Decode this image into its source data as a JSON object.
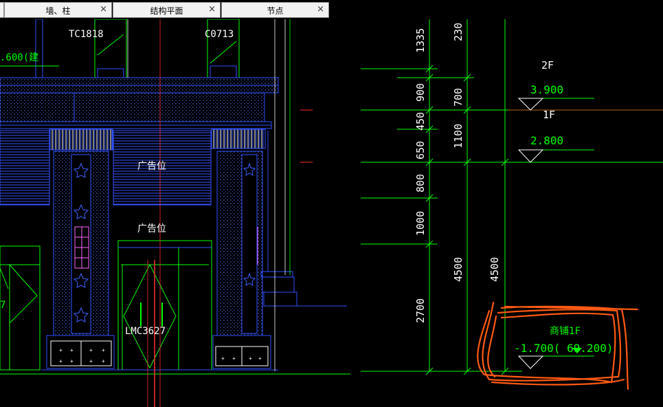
{
  "tabs": [
    {
      "label": "墙、柱",
      "close": "×"
    },
    {
      "label": "结构平面",
      "close": "×"
    },
    {
      "label": "节点",
      "close": "×"
    }
  ],
  "drawing": {
    "window_top_left": "TC1818",
    "window_top_right": "C0713",
    "cut_label": ".600(建",
    "ad_label_1": "广告位",
    "ad_label_2": "广告位",
    "door_label": "LMC3627",
    "door_left_partial": "7",
    "dims_col1": [
      "1335",
      "900",
      "450",
      "650",
      "800",
      "1000",
      "2700"
    ],
    "dims_col2": [
      "230",
      "700",
      "1100",
      "4500"
    ],
    "dims_col3": [
      "4500"
    ],
    "level_2f_name": "2F",
    "level_2f_value": "3.900",
    "level_1f_name": "1F",
    "level_1f_value": "2.800",
    "level_shop_name": "商铺1F",
    "level_shop_value": "-1.700( 69.200)"
  },
  "colors": {
    "background": "#000000",
    "cad_white": "#ffffff",
    "cad_green": "#00ff00",
    "cad_blue": "#3050ff",
    "cad_red": "#ff3030",
    "annotation": "#ff5a14"
  }
}
